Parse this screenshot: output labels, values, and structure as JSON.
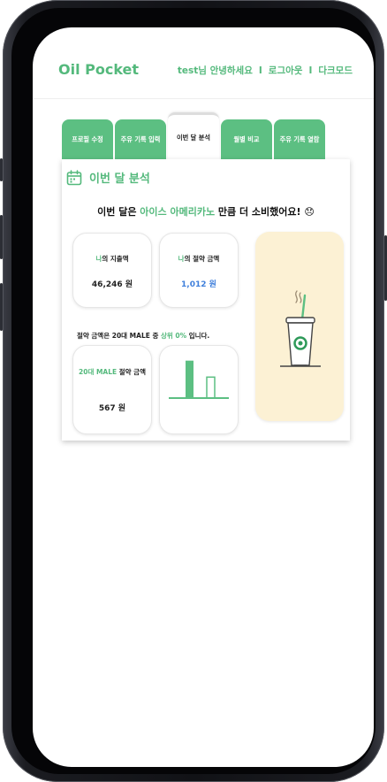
{
  "app": {
    "logo": "Oil Pocket"
  },
  "nav": {
    "greeting": "test님 안녕하세요",
    "separator": "I",
    "logout": "로그아웃",
    "darkmode": "다크모드"
  },
  "tabs": [
    {
      "label": "프로필 수정",
      "active": false
    },
    {
      "label": "주유 기록 입력",
      "active": false
    },
    {
      "label": "이번 달 분석",
      "active": true
    },
    {
      "label": "월별 비교",
      "active": false
    },
    {
      "label": "주유 기록 열람",
      "active": false
    }
  ],
  "analysis": {
    "title": "이번 달 분석",
    "headline_pre": "이번 달은 ",
    "headline_item": "아이스 아메리카노",
    "headline_post": " 만큼 더 소비했어요! 😞",
    "spend": {
      "label_hl": "나",
      "label_rest": "의 지출액",
      "value": "46,246 원"
    },
    "saving": {
      "label_hl": "나",
      "label_rest": "의 절약 금액",
      "value": "1,012 원"
    },
    "compare": {
      "pre": "절약 금액은 20대 MALE 중 ",
      "hl": "상위 0%",
      "post": " 입니다."
    },
    "peer": {
      "label_hl": "20대 MALE",
      "label_rest": " 절약 금액",
      "value": "567 원"
    },
    "icons": {
      "calendar": "calendar-icon",
      "drink": "iced-coffee-icon"
    }
  },
  "chart_data": {
    "type": "bar",
    "categories": [
      "나",
      "20대 MALE"
    ],
    "values": [
      1012,
      567
    ],
    "title": "",
    "xlabel": "",
    "ylabel": "",
    "ylim": [
      0,
      1100
    ],
    "colors": [
      "#5cbf82",
      "#5cbf82"
    ]
  },
  "colors": {
    "accent": "#54b97c",
    "tab": "#5cbf82",
    "blue": "#3f7fdb",
    "yellow": "#fcf1d4"
  }
}
